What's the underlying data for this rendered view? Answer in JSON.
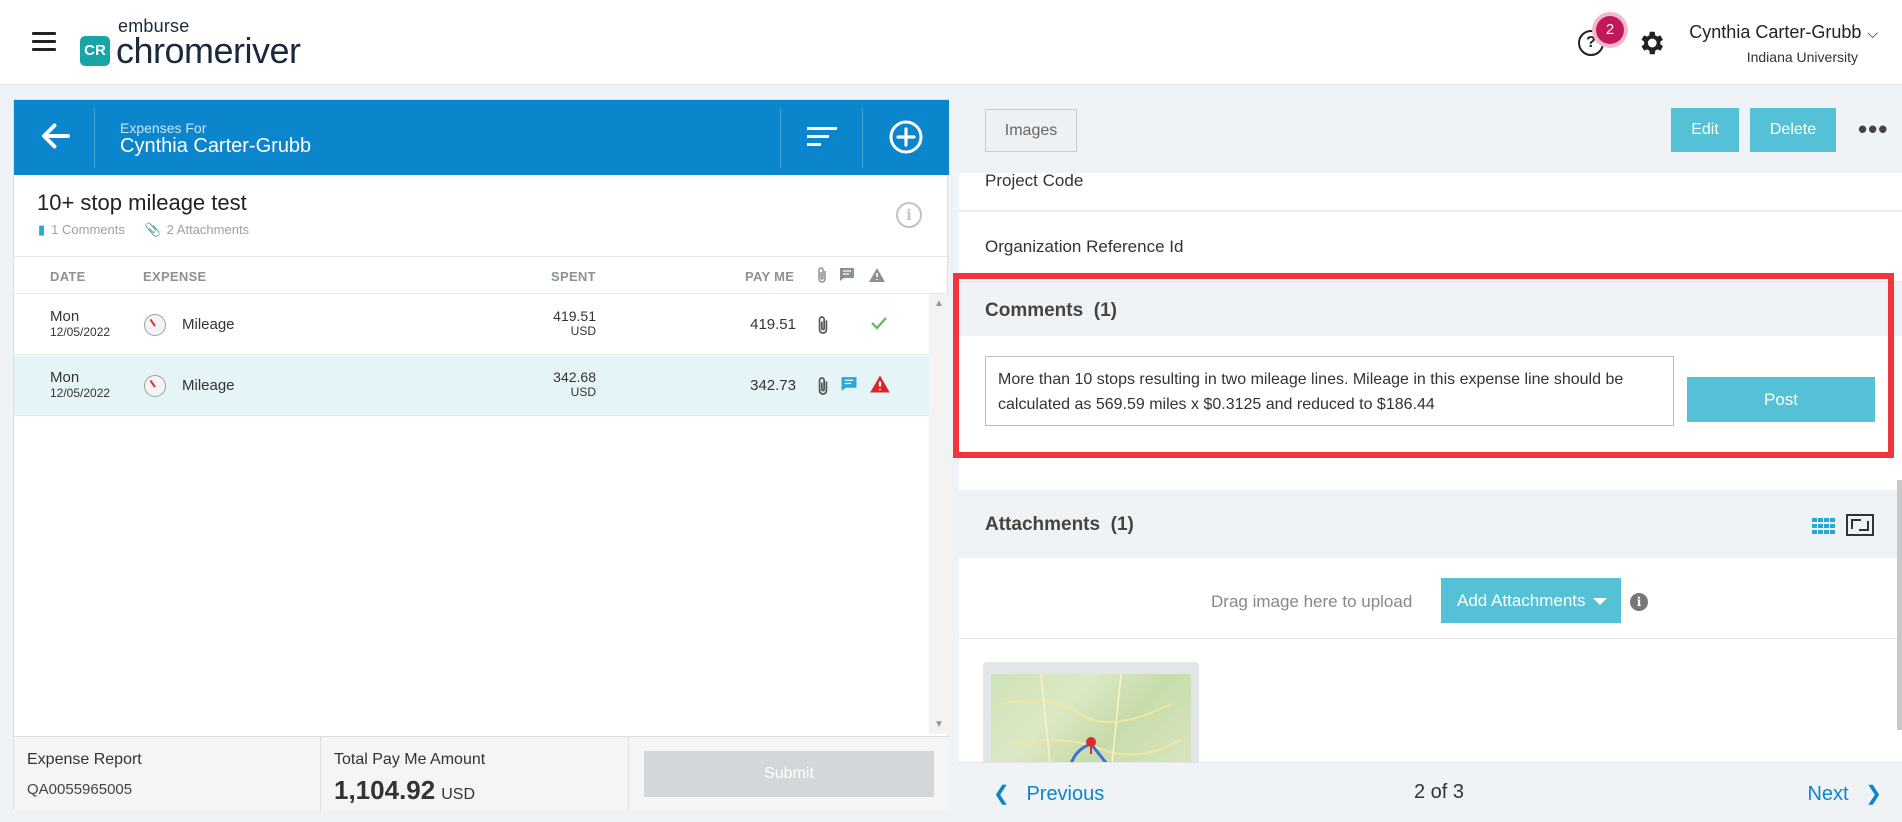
{
  "app": {
    "brand_top": "emburse",
    "brand_main": "chromeriver",
    "brand_mark": "CR"
  },
  "header": {
    "help_glyph": "?",
    "notification_count": "2",
    "user_name": "Cynthia Carter-Grubb",
    "user_org": "Indiana University",
    "colors": {
      "badge": "#c0185a",
      "accent": "#0b85cc"
    }
  },
  "left_panel": {
    "subtitle": "Expenses For",
    "owner": "Cynthia Carter-Grubb",
    "report_title": "10+ stop mileage test",
    "comments_count": "1 Comments",
    "attachments_count": "2 Attachments",
    "info_glyph": "i",
    "columns": {
      "date": "DATE",
      "expense": "EXPENSE",
      "spent": "SPENT",
      "pay_me": "PAY ME"
    },
    "rows": [
      {
        "day": "Mon",
        "date": "12/05/2022",
        "expense": "Mileage",
        "spent": "419.51",
        "spent_currency": "USD",
        "pay_me": "419.51",
        "status": "ok",
        "has_comment": false,
        "selected": false
      },
      {
        "day": "Mon",
        "date": "12/05/2022",
        "expense": "Mileage",
        "spent": "342.68",
        "spent_currency": "USD",
        "pay_me": "342.73",
        "status": "warning",
        "has_comment": true,
        "selected": true
      }
    ],
    "footer": {
      "report_label": "Expense Report",
      "report_id": "QA0055965005",
      "total_label": "Total Pay Me Amount",
      "total_value": "1,104.92",
      "total_currency": "USD",
      "submit_label": "Submit"
    }
  },
  "right_panel": {
    "images_label": "Images",
    "edit_label": "Edit",
    "delete_label": "Delete",
    "more_label": "•••",
    "fields": {
      "project_code": "Project Code",
      "org_ref": "Organization Reference Id"
    },
    "comments": {
      "title": "Comments  (1)",
      "text": "More than 10 stops resulting in two mileage lines. Mileage in this expense line should be calculated as 569.59 miles x $0.3125 and reduced to $186.44",
      "post_label": "Post"
    },
    "attachments": {
      "title": "Attachments  (1)",
      "drag_text": "Drag image here to upload",
      "add_label": "Add Attachments",
      "info_glyph": "i"
    },
    "pager": {
      "previous": "Previous",
      "position": "2 of 3",
      "next": "Next"
    }
  }
}
